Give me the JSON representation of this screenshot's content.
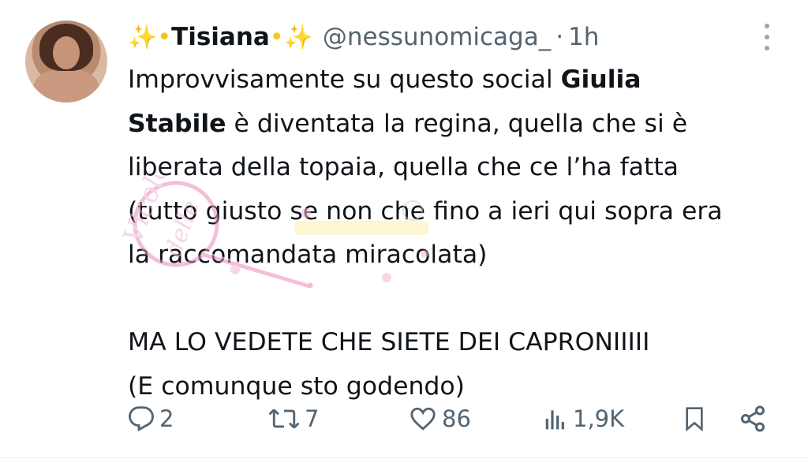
{
  "tweet": {
    "author": {
      "name_prefix": "✨•",
      "name": "Tisiana",
      "name_suffix": "•✨",
      "handle": "@nessunomicaga_",
      "separator": "·",
      "time": "1h"
    },
    "body": {
      "line1_plain": "Improvvisamente su questo social ",
      "line1_bold": "Giulia",
      "line2_bold": "Stabile",
      "line2_plain": " è diventata la regina, quella che si è",
      "line3": "liberata della topaia, quella che ce l’ha fatta",
      "line4": "(tutto giusto se non che fino a ieri qui sopra era",
      "line5": "la raccomandata miracolata)",
      "line6": "MA LO VEDETE CHE SIETE DEI CAPRONIIIII",
      "line7": "(E comunque sto godendo)"
    },
    "actions": {
      "replies": "2",
      "retweets": "7",
      "likes": "86",
      "views": "1,9K"
    }
  },
  "icons": {
    "reply": "reply-icon",
    "retweet": "retweet-icon",
    "like": "heart-icon",
    "views": "views-icon",
    "bookmark": "bookmark-icon",
    "share": "share-icon",
    "more": "more-icon"
  },
  "colors": {
    "text": "#0f1419",
    "secondary": "#536471",
    "sparkle": "#f5c518",
    "watermark_pink": "#e88bbd"
  }
}
